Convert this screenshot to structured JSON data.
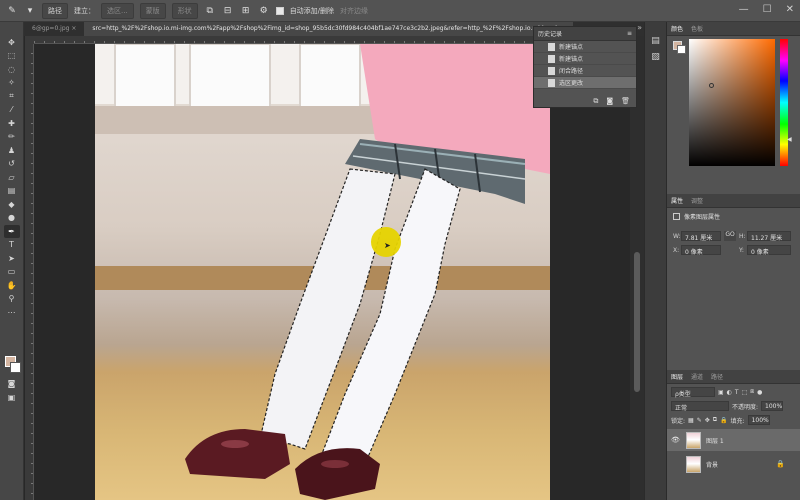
{
  "options_bar": {
    "mode_select": "路径",
    "build_button": "建立：",
    "selection_button": "选区...",
    "mask_button": "蒙版",
    "shape_button": "形状",
    "auto_add_delete_label": "自动添加/删除",
    "align_edges_label": "对齐边缘"
  },
  "tabs": {
    "tab1": "6@gp=0.jpg",
    "tab2": "src=http_%2F%2Fshop.io.mi-img.com%2Fapp%2Fshop%2Fimg_id=shop_95b5dc30fd984c404bf1ae747ce3c2b2.jpeg&refer=http_%2F%2Fshop.io.mi-img.jpg"
  },
  "history_panel": {
    "title": "历史记录",
    "items": [
      {
        "label": "新建锚点"
      },
      {
        "label": "新建锚点"
      },
      {
        "label": "闭合路径"
      },
      {
        "label": "选区更改"
      }
    ]
  },
  "color_panel": {
    "tabs": [
      "颜色",
      "色板"
    ],
    "foreground": "#d4b5a1",
    "background": "#ffffff"
  },
  "properties_panel": {
    "tabs": [
      "属性",
      "调整"
    ],
    "title": "像素图层属性",
    "w_label": "W:",
    "w_value": "7.81 厘米",
    "h_label": "H:",
    "h_value": "11.27 厘米",
    "x_label": "X:",
    "x_value": "0 像素",
    "y_label": "Y:",
    "y_value": "0 像素",
    "link_label": "GO"
  },
  "layers_panel": {
    "tabs": [
      "图层",
      "通道",
      "路径"
    ],
    "kind_filter": "ρ类型",
    "blend_mode": "正常",
    "opacity_label": "不透明度:",
    "opacity_value": "100%",
    "lock_label": "锁定:",
    "fill_label": "填充:",
    "fill_value": "100%",
    "layers": [
      {
        "name": "图层 1",
        "visible": true,
        "selected": true
      },
      {
        "name": "背景",
        "visible": false,
        "selected": false,
        "locked": true
      }
    ]
  }
}
